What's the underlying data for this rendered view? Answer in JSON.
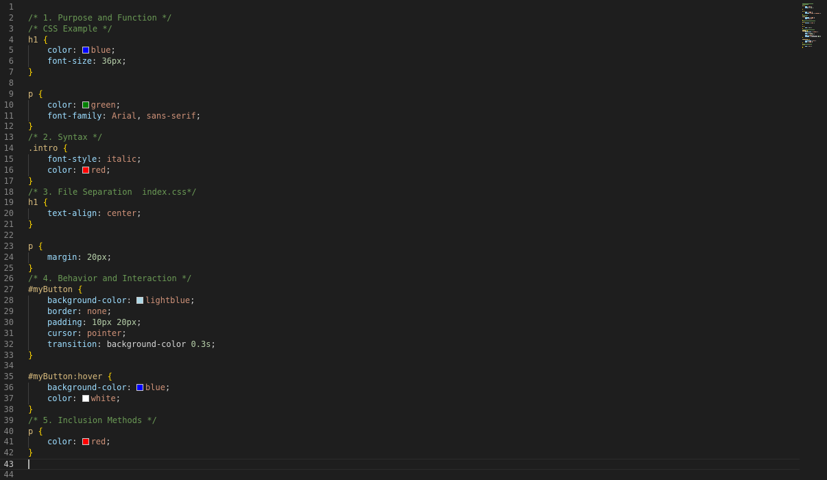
{
  "editor": {
    "language": "css",
    "current_line": 43,
    "lines": [
      {
        "n": "1",
        "i": 0,
        "t": []
      },
      {
        "n": "2",
        "i": 0,
        "t": [
          [
            "comment",
            "/* 1. Purpose and Function */"
          ]
        ]
      },
      {
        "n": "3",
        "i": 0,
        "t": [
          [
            "comment",
            "/* CSS Example */"
          ]
        ]
      },
      {
        "n": "4",
        "i": 0,
        "t": [
          [
            "sel",
            "h1 "
          ],
          [
            "brace",
            "{"
          ]
        ]
      },
      {
        "n": "5",
        "i": 1,
        "t": [
          [
            "prop",
            "color"
          ],
          [
            "punc",
            ": "
          ],
          [
            "sw",
            "#0000ff"
          ],
          [
            "val",
            "blue"
          ],
          [
            "punc",
            ";"
          ]
        ]
      },
      {
        "n": "6",
        "i": 1,
        "t": [
          [
            "prop",
            "font-size"
          ],
          [
            "punc",
            ": "
          ],
          [
            "num",
            "36px"
          ],
          [
            "punc",
            ";"
          ]
        ]
      },
      {
        "n": "7",
        "i": 0,
        "t": [
          [
            "brace",
            "}"
          ]
        ]
      },
      {
        "n": "8",
        "i": 0,
        "t": []
      },
      {
        "n": "9",
        "i": 0,
        "t": [
          [
            "sel",
            "p "
          ],
          [
            "brace",
            "{"
          ]
        ]
      },
      {
        "n": "10",
        "i": 1,
        "t": [
          [
            "prop",
            "color"
          ],
          [
            "punc",
            ": "
          ],
          [
            "sw",
            "#008000"
          ],
          [
            "val",
            "green"
          ],
          [
            "punc",
            ";"
          ]
        ]
      },
      {
        "n": "11",
        "i": 1,
        "t": [
          [
            "prop",
            "font-family"
          ],
          [
            "punc",
            ": "
          ],
          [
            "val",
            "Arial"
          ],
          [
            "punc",
            ", "
          ],
          [
            "val",
            "sans-serif"
          ],
          [
            "punc",
            ";"
          ]
        ]
      },
      {
        "n": "12",
        "i": 0,
        "t": [
          [
            "brace",
            "}"
          ]
        ]
      },
      {
        "n": "13",
        "i": 0,
        "t": [
          [
            "comment",
            "/* 2. Syntax */"
          ]
        ]
      },
      {
        "n": "14",
        "i": 0,
        "t": [
          [
            "sel",
            ".intro "
          ],
          [
            "brace",
            "{"
          ]
        ]
      },
      {
        "n": "15",
        "i": 1,
        "t": [
          [
            "prop",
            "font-style"
          ],
          [
            "punc",
            ": "
          ],
          [
            "val",
            "italic"
          ],
          [
            "punc",
            ";"
          ]
        ]
      },
      {
        "n": "16",
        "i": 1,
        "t": [
          [
            "prop",
            "color"
          ],
          [
            "punc",
            ": "
          ],
          [
            "sw",
            "#ff0000"
          ],
          [
            "val",
            "red"
          ],
          [
            "punc",
            ";"
          ]
        ]
      },
      {
        "n": "17",
        "i": 0,
        "t": [
          [
            "brace",
            "}"
          ]
        ]
      },
      {
        "n": "18",
        "i": 0,
        "t": [
          [
            "comment",
            "/* 3. File Separation  index.css*/"
          ]
        ]
      },
      {
        "n": "19",
        "i": 0,
        "t": [
          [
            "sel",
            "h1 "
          ],
          [
            "brace",
            "{"
          ]
        ]
      },
      {
        "n": "20",
        "i": 1,
        "t": [
          [
            "prop",
            "text-align"
          ],
          [
            "punc",
            ": "
          ],
          [
            "val",
            "center"
          ],
          [
            "punc",
            ";"
          ]
        ]
      },
      {
        "n": "21",
        "i": 0,
        "t": [
          [
            "brace",
            "}"
          ]
        ]
      },
      {
        "n": "22",
        "i": 0,
        "t": []
      },
      {
        "n": "23",
        "i": 0,
        "t": [
          [
            "sel",
            "p "
          ],
          [
            "brace",
            "{"
          ]
        ]
      },
      {
        "n": "24",
        "i": 1,
        "t": [
          [
            "prop",
            "margin"
          ],
          [
            "punc",
            ": "
          ],
          [
            "num",
            "20px"
          ],
          [
            "punc",
            ";"
          ]
        ]
      },
      {
        "n": "25",
        "i": 0,
        "t": [
          [
            "brace",
            "}"
          ]
        ]
      },
      {
        "n": "26",
        "i": 0,
        "t": [
          [
            "comment",
            "/* 4. Behavior and Interaction */"
          ]
        ]
      },
      {
        "n": "27",
        "i": 0,
        "t": [
          [
            "sel",
            "#myButton "
          ],
          [
            "brace",
            "{"
          ]
        ]
      },
      {
        "n": "28",
        "i": 1,
        "t": [
          [
            "prop",
            "background-color"
          ],
          [
            "punc",
            ": "
          ],
          [
            "sw",
            "#add8e6"
          ],
          [
            "val",
            "lightblue"
          ],
          [
            "punc",
            ";"
          ]
        ]
      },
      {
        "n": "29",
        "i": 1,
        "t": [
          [
            "prop",
            "border"
          ],
          [
            "punc",
            ": "
          ],
          [
            "val",
            "none"
          ],
          [
            "punc",
            ";"
          ]
        ]
      },
      {
        "n": "30",
        "i": 1,
        "t": [
          [
            "prop",
            "padding"
          ],
          [
            "punc",
            ": "
          ],
          [
            "num",
            "10px 20px"
          ],
          [
            "punc",
            ";"
          ]
        ]
      },
      {
        "n": "31",
        "i": 1,
        "t": [
          [
            "prop",
            "cursor"
          ],
          [
            "punc",
            ": "
          ],
          [
            "val",
            "pointer"
          ],
          [
            "punc",
            ";"
          ]
        ]
      },
      {
        "n": "32",
        "i": 1,
        "t": [
          [
            "prop",
            "transition"
          ],
          [
            "punc",
            ": "
          ],
          [
            "punc",
            "background-color "
          ],
          [
            "num",
            "0.3s"
          ],
          [
            "punc",
            ";"
          ]
        ]
      },
      {
        "n": "33",
        "i": 0,
        "t": [
          [
            "brace",
            "}"
          ]
        ]
      },
      {
        "n": "34",
        "i": 0,
        "t": []
      },
      {
        "n": "35",
        "i": 0,
        "t": [
          [
            "sel",
            "#myButton:hover "
          ],
          [
            "brace",
            "{"
          ]
        ]
      },
      {
        "n": "36",
        "i": 1,
        "t": [
          [
            "prop",
            "background-color"
          ],
          [
            "punc",
            ": "
          ],
          [
            "sw",
            "#0000ff"
          ],
          [
            "val",
            "blue"
          ],
          [
            "punc",
            ";"
          ]
        ]
      },
      {
        "n": "37",
        "i": 1,
        "t": [
          [
            "prop",
            "color"
          ],
          [
            "punc",
            ": "
          ],
          [
            "sw",
            "#ffffff"
          ],
          [
            "val",
            "white"
          ],
          [
            "punc",
            ";"
          ]
        ]
      },
      {
        "n": "38",
        "i": 0,
        "t": [
          [
            "brace",
            "}"
          ]
        ]
      },
      {
        "n": "39",
        "i": 0,
        "t": [
          [
            "comment",
            "/* 5. Inclusion Methods */"
          ]
        ]
      },
      {
        "n": "40",
        "i": 0,
        "t": [
          [
            "sel",
            "p "
          ],
          [
            "brace",
            "{"
          ]
        ]
      },
      {
        "n": "41",
        "i": 1,
        "t": [
          [
            "prop",
            "color"
          ],
          [
            "punc",
            ": "
          ],
          [
            "sw",
            "#ff0000"
          ],
          [
            "val",
            "red"
          ],
          [
            "punc",
            ";"
          ]
        ]
      },
      {
        "n": "42",
        "i": 0,
        "t": [
          [
            "brace",
            "}"
          ]
        ]
      },
      {
        "n": "43",
        "i": 0,
        "t": [
          [
            "cursor",
            ""
          ]
        ]
      },
      {
        "n": "44",
        "i": 0,
        "t": []
      }
    ]
  },
  "colors": {
    "background": "#1e1e1e",
    "comment": "#6a9955",
    "selector": "#d7ba7d",
    "brace": "#ffd700",
    "property": "#9cdcfe",
    "value": "#ce9178",
    "number": "#b5cea8"
  }
}
